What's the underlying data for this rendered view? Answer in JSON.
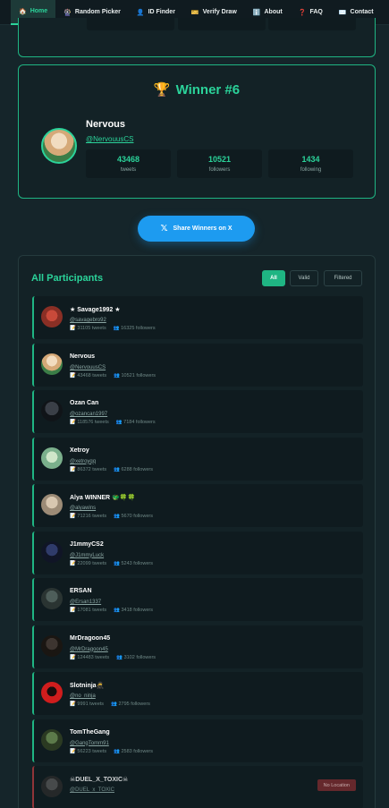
{
  "nav": {
    "items": [
      {
        "icon": "🏠",
        "label": "Home",
        "active": true
      },
      {
        "icon": "🎡",
        "label": "Random Picker",
        "active": false
      },
      {
        "icon": "👤",
        "label": "ID Finder",
        "active": false
      },
      {
        "icon": "🎫",
        "label": "Verify Draw",
        "active": false
      },
      {
        "icon": "ℹ️",
        "label": "About",
        "active": false
      },
      {
        "icon": "❓",
        "label": "FAQ",
        "active": false
      },
      {
        "icon": "✉️",
        "label": "Contact",
        "active": false
      }
    ]
  },
  "winner": {
    "trophy": "🏆",
    "title": "Winner #6",
    "name": "Nervous",
    "handle": "@NervouusCS",
    "stats": [
      {
        "value": "43468",
        "label": "tweets"
      },
      {
        "value": "10521",
        "label": "followers"
      },
      {
        "value": "1434",
        "label": "following"
      }
    ]
  },
  "share": {
    "label": "Share Winners on X",
    "icon": "𝕏"
  },
  "participants": {
    "title": "All Participants",
    "filters": [
      "All",
      "Valid",
      "Filtered"
    ],
    "rows": [
      {
        "name": "★ Savage1992 ★",
        "handle": "@savagebro92",
        "tweets": "31105 tweets",
        "followers": "16325 followers"
      },
      {
        "name": "Nervous",
        "handle": "@NervouusCS",
        "tweets": "43468 tweets",
        "followers": "10521 followers"
      },
      {
        "name": "Ozan Can",
        "handle": "@ozancan1997",
        "tweets": "118576 tweets",
        "followers": "7184 followers"
      },
      {
        "name": "Xetroy",
        "handle": "@xetroyqq",
        "tweets": "86372 tweets",
        "followers": "6288 followers"
      },
      {
        "name": "Alya WINNER 🐲🍀🍀",
        "handle": "@alyawins",
        "tweets": "71216 tweets",
        "followers": "5670 followers"
      },
      {
        "name": "J1mmyCS2",
        "handle": "@J1mmyLuck",
        "tweets": "22099 tweets",
        "followers": "5243 followers"
      },
      {
        "name": "ERSAN",
        "handle": "@Ersan1337",
        "tweets": "17081 tweets",
        "followers": "3418 followers"
      },
      {
        "name": "MrDragoon45",
        "handle": "@MrDragoon45",
        "tweets": "124483 tweets",
        "followers": "3102 followers"
      },
      {
        "name": "Slotninja🥷",
        "handle": "@no_ninja",
        "tweets": "9991 tweets",
        "followers": "2795 followers"
      },
      {
        "name": "TomTheGang",
        "handle": "@GangTomm91",
        "tweets": "56223 tweets",
        "followers": "2583 followers"
      },
      {
        "name": "☠DUEL_X_TOXIC☠",
        "handle": "@DUEL_x_TOXIC",
        "tweets": "",
        "followers": "",
        "badge": "No Location"
      }
    ]
  },
  "icons": {
    "tweets": "📝",
    "followers": "👥"
  }
}
